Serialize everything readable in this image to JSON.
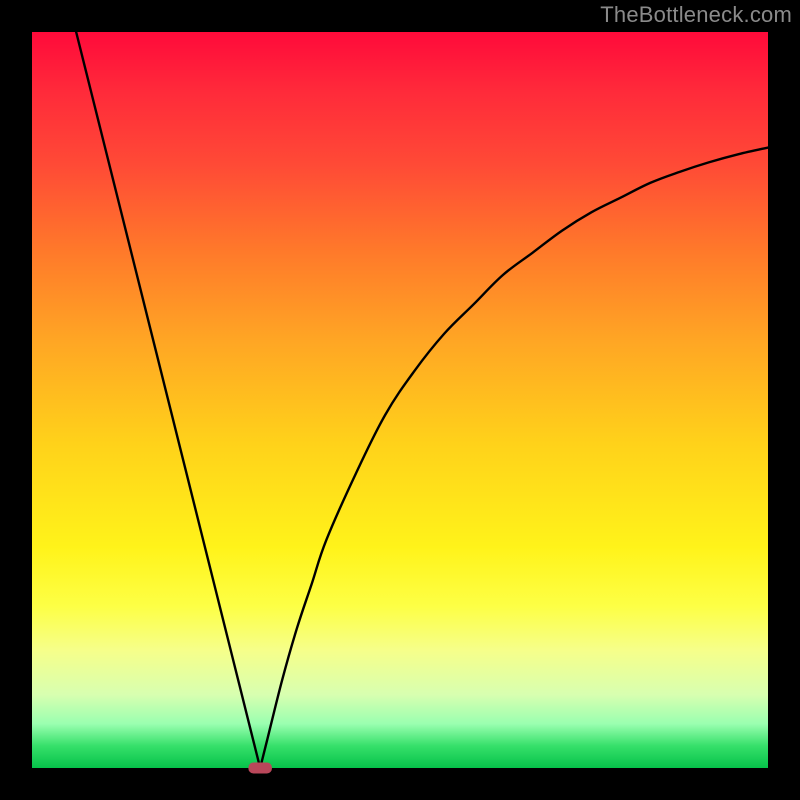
{
  "domain": "Chart",
  "watermark": "TheBottleneck.com",
  "colors": {
    "frame": "#000000",
    "curve": "#000000",
    "gradient_top": "#ff0a3a",
    "gradient_bottom": "#06c24a",
    "marker": "#b9475a"
  },
  "chart_data": {
    "type": "line",
    "title": "",
    "xlabel": "",
    "ylabel": "",
    "xlim": [
      0,
      100
    ],
    "ylim": [
      0,
      100
    ],
    "grid": false,
    "legend": false,
    "series": [
      {
        "name": "left-branch",
        "x": [
          6,
          8,
          10,
          12,
          14,
          16,
          18,
          20,
          22,
          24,
          26,
          28,
          30,
          31
        ],
        "y": [
          100,
          92,
          84,
          76,
          68,
          60,
          52,
          44,
          36,
          28,
          20,
          12,
          4,
          0
        ]
      },
      {
        "name": "right-branch",
        "x": [
          31,
          32,
          34,
          36,
          38,
          40,
          44,
          48,
          52,
          56,
          60,
          64,
          68,
          72,
          76,
          80,
          84,
          88,
          92,
          96,
          100
        ],
        "y": [
          0,
          4,
          12,
          19,
          25,
          31,
          40,
          48,
          54,
          59,
          63,
          67,
          70,
          73,
          75.5,
          77.5,
          79.5,
          81,
          82.3,
          83.4,
          84.3
        ]
      }
    ],
    "marker": {
      "x": 31,
      "y": 0,
      "w": 3.2,
      "h": 1.5
    }
  }
}
